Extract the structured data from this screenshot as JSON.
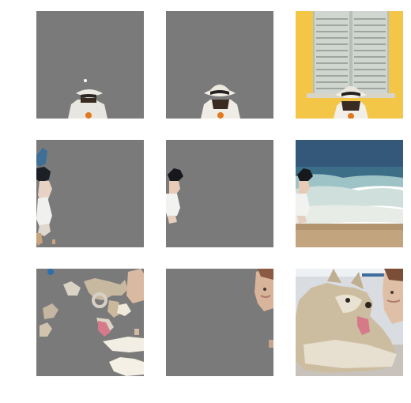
{
  "colors": {
    "background": "#ffffff",
    "mask_gray": "#7a7a7a",
    "wall_yellow": "#f3c648",
    "shutter_gray": "#c9cfc9",
    "sea_blue": "#3f6f8d",
    "sand": "#b49470",
    "dog_fur": "#cdbda0",
    "tongue_pink": "#d67a8a"
  },
  "grid": {
    "rows": [
      {
        "subject": "girl-with-sun-hat",
        "tiles": [
          "mask-hat-fragment",
          "mask-girl-with-hat",
          "original-girl-at-window"
        ]
      },
      {
        "subject": "child-on-beach",
        "tiles": [
          "mask-scattered-child",
          "mask-child-only",
          "original-beach-scene"
        ]
      },
      {
        "subject": "husky-and-person",
        "tiles": [
          "mask-dog-fragments",
          "mask-person-face",
          "original-husky-photo"
        ]
      }
    ]
  }
}
